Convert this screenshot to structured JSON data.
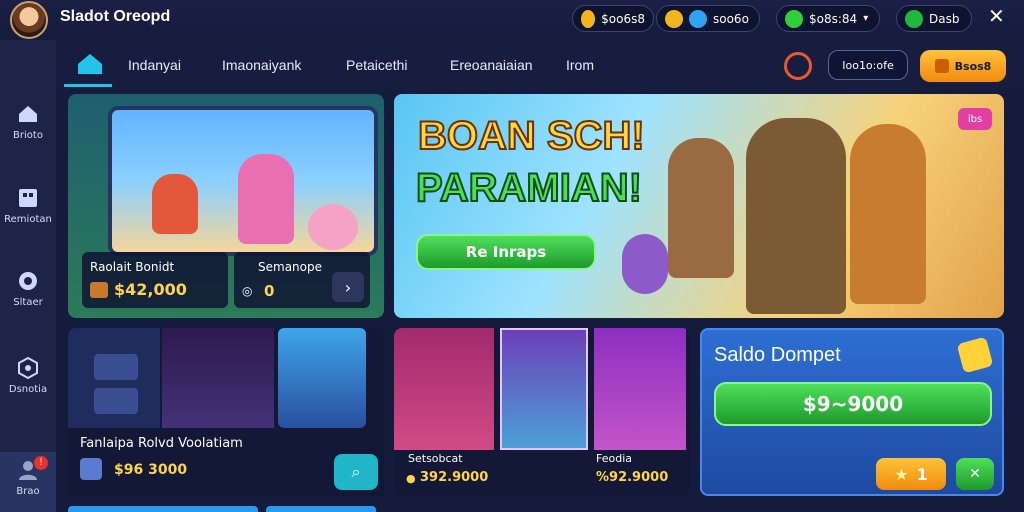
{
  "header": {
    "title": "Sladot Oreopd",
    "currency_a": "$oo6s8",
    "currency_b": "soo6o",
    "currency_c": "$o8s:84",
    "currency_d": "Dasb",
    "close_icon": "✕"
  },
  "sidebar": {
    "items": [
      {
        "label": "Brioto",
        "icon": "home-icon"
      },
      {
        "label": "Remiotan",
        "icon": "grid-icon"
      },
      {
        "label": "Sltaer",
        "icon": "gear-icon"
      },
      {
        "label": "Dsnotia",
        "icon": "hex-icon"
      },
      {
        "label": "Brao",
        "icon": "profile-icon",
        "badge": "!"
      }
    ]
  },
  "tabs": [
    {
      "label": "Indanyai"
    },
    {
      "label": "Imaonaiyank"
    },
    {
      "label": "Petaicethi"
    },
    {
      "label": "Ereoanaiaian"
    },
    {
      "label": "Irom"
    }
  ],
  "topRight": {
    "small_button": "Ioo1o:ofe",
    "yellow_button": "Bsos8"
  },
  "hero_left": {
    "card1_title": "Raolait Bonidt",
    "card1_value": "$42,000",
    "card2_title": "Semanope",
    "card2_value": "0"
  },
  "hero_right": {
    "headline1": "BOAN SCH!",
    "headline2": "PARAMIAN!",
    "cta": "Re Inraps",
    "corner_badge": "ibs"
  },
  "bottom_left": {
    "title": "Fanlaipa Rolvd Voolatiam",
    "value": "$96 3000"
  },
  "bottom_mid": {
    "card1_title": "Setsobcat",
    "card1_value": "392.9000",
    "card2_title": "Feodia",
    "card2_value": "%92.9000"
  },
  "wallet": {
    "title": "Saldo Dompet",
    "balance": "$9~9000",
    "small_btn": "1"
  },
  "colors": {
    "accent_cyan": "#22c4e8",
    "green": "#2ecf3b",
    "orange": "#f7a21b"
  }
}
